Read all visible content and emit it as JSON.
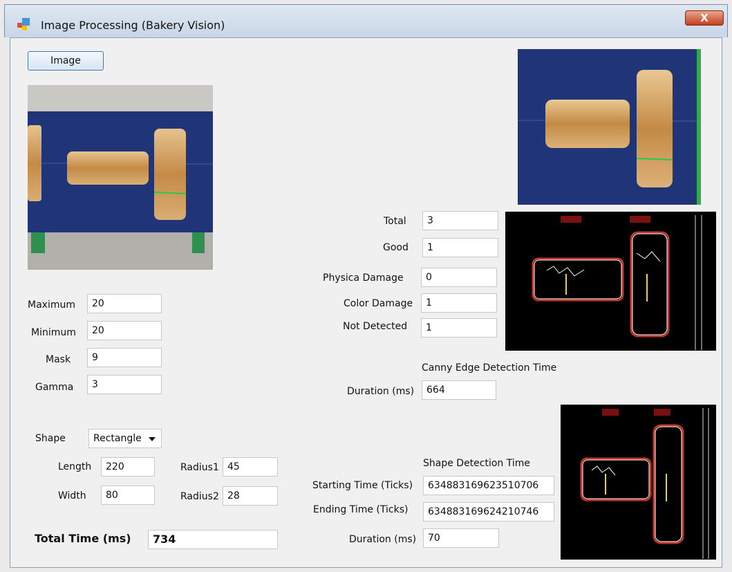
{
  "window": {
    "title": "Image Processing (Bakery Vision)",
    "close_glyph": "X"
  },
  "toolbar": {
    "image_button": "Image"
  },
  "params": {
    "maximum": {
      "label": "Maximum",
      "value": "20"
    },
    "minimum": {
      "label": "Minimum",
      "value": "20"
    },
    "mask": {
      "label": "Mask",
      "value": "9"
    },
    "gamma": {
      "label": "Gamma",
      "value": "3"
    }
  },
  "shape": {
    "label": "Shape",
    "selected": "Rectangle",
    "length": {
      "label": "Length",
      "value": "220"
    },
    "width": {
      "label": "Width",
      "value": "80"
    },
    "radius1": {
      "label": "Radius1",
      "value": "45"
    },
    "radius2": {
      "label": "Radius2",
      "value": "28"
    }
  },
  "total_time": {
    "label": "Total Time (ms)",
    "value": "734"
  },
  "counts": {
    "total": {
      "label": "Total",
      "value": "3"
    },
    "good": {
      "label": "Good",
      "value": "1"
    },
    "physical_damage": {
      "label": "Physica Damage",
      "value": "0"
    },
    "color_damage": {
      "label": "Color Damage",
      "value": "1"
    },
    "not_detected": {
      "label": "Not Detected",
      "value": "1"
    }
  },
  "canny": {
    "heading": "Canny Edge Detection Time",
    "duration": {
      "label": "Duration (ms)",
      "value": "664"
    }
  },
  "shape_detection": {
    "heading": "Shape Detection Time",
    "start": {
      "label": "Starting Time (Ticks)",
      "value": "634883169623510706"
    },
    "end": {
      "label": "Ending Time (Ticks)",
      "value": "634883169624210746"
    },
    "duration": {
      "label": "Duration (ms)",
      "value": "70"
    }
  },
  "colors": {
    "belt": "#1f3578",
    "bread": "#c98f4a",
    "edge_box": "#c0392b"
  }
}
